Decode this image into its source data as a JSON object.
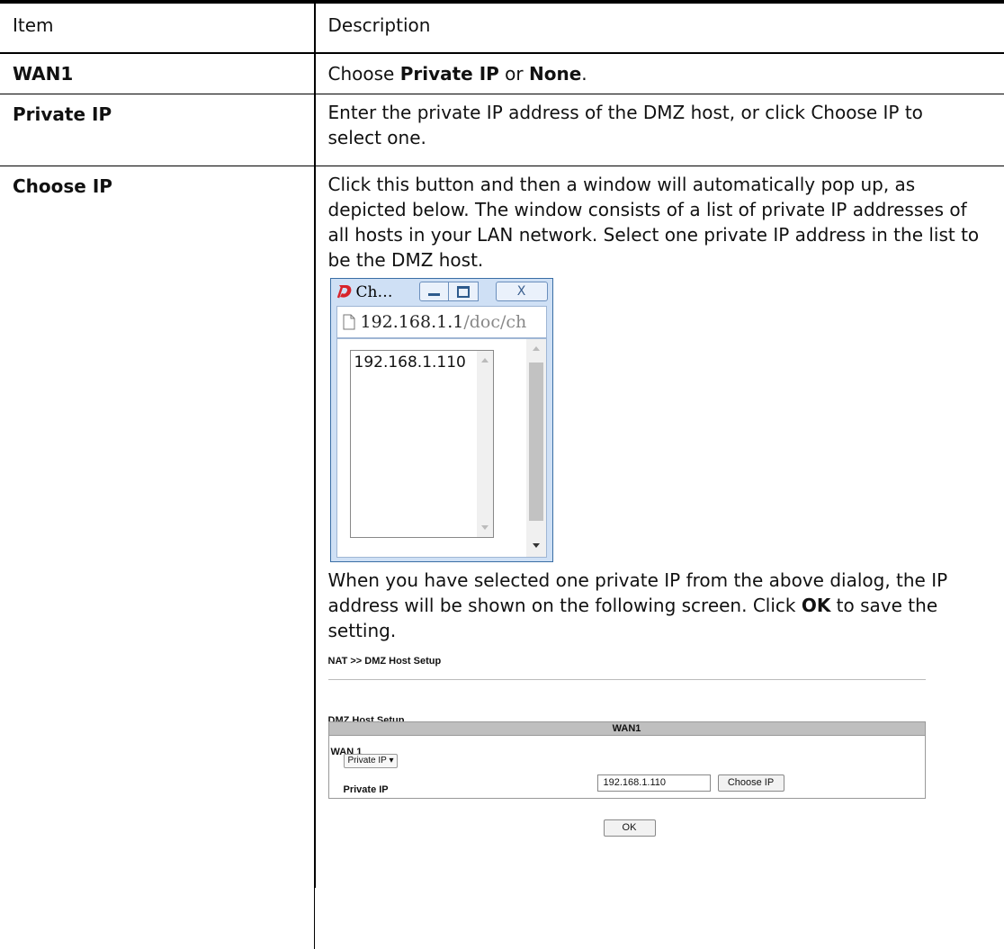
{
  "table": {
    "headers": {
      "item": "Item",
      "description": "Description"
    },
    "rows": [
      {
        "item": "WAN1",
        "desc": {
          "t1": "Choose ",
          "b1": "Private IP",
          "t2": " or ",
          "b2": "None",
          "t3": "."
        }
      },
      {
        "item": "Private IP",
        "desc": {
          "text": "Enter the private IP address of the DMZ host, or click Choose IP to select one."
        }
      },
      {
        "item": "Choose IP",
        "desc": {
          "intro": "Click this button and then a window will automatically pop up, as depicted below. The window consists of a list of private IP addresses of all hosts in your LAN network. Select one private IP address in the list to be the DMZ host.",
          "after_t1": "When you have selected one private IP from the above dialog, the IP address will be shown on the following screen. Click ",
          "after_b1": "OK",
          "after_t2": " to save the setting."
        }
      }
    ]
  },
  "popup": {
    "title": "Ch…",
    "address_host": "192.168.1.1",
    "address_path": "/doc/ch",
    "list_items": [
      "192.168.1.110"
    ],
    "close_label": "X"
  },
  "nat_panel": {
    "breadcrumb": "NAT >> DMZ Host Setup",
    "section_title": "DMZ Host Setup",
    "tab_header": "WAN1",
    "wan_label": "WAN 1",
    "mode_select": "Private IP ▾",
    "private_ip_label": "Private IP",
    "private_ip_value": "192.168.1.110",
    "choose_ip_button": "Choose IP",
    "ok_button": "OK"
  },
  "colors": {
    "popup_frame": "#cfe0f5",
    "popup_border": "#3a6ea5",
    "header_bar": "#bfbfbf"
  }
}
